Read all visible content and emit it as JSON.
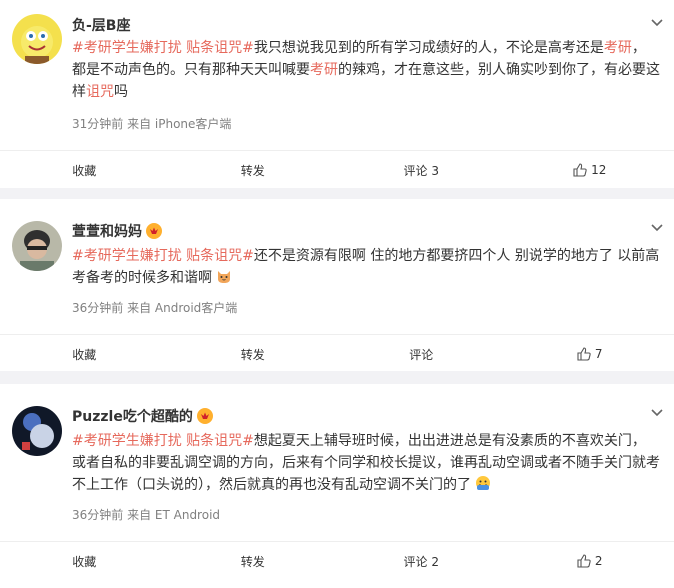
{
  "comments": [
    {
      "author": "负-层B座",
      "text_parts": [
        {
          "t": "#考研学生嫌打扰 贴条诅咒#",
          "hl": true
        },
        {
          "t": "我只想说我见到的所有学习成绩好的人，不论是高考还是",
          "hl": false
        },
        {
          "t": "考研",
          "hl": true
        },
        {
          "t": "，\n都是不动声色的。只有那种天天叫喊要",
          "hl": false
        },
        {
          "t": "考研",
          "hl": true
        },
        {
          "t": "的辣鸡，才在意这些，别人确实吵到你了，有必要这\n样",
          "hl": false
        },
        {
          "t": "诅咒",
          "hl": true
        },
        {
          "t": "吗",
          "hl": false
        }
      ],
      "meta": "31分钟前 来自 iPhone客户端",
      "actions": {
        "collect": "收藏",
        "repost": "转发",
        "comment": "评论 3",
        "like": "12"
      }
    },
    {
      "author": "萱萱和妈妈",
      "text_parts": [
        {
          "t": "#考研学生嫌打扰 贴条诅咒#",
          "hl": true
        },
        {
          "t": "还不是资源有限啊 住的地方都要挤四个人 别说学的地方了 以前高\n考备考的时候多和谐啊",
          "hl": false
        }
      ],
      "meta": "36分钟前 来自 Android客户端",
      "actions": {
        "collect": "收藏",
        "repost": "转发",
        "comment": "评论",
        "like": "7"
      }
    },
    {
      "author": "Puzzle吃个超酷的",
      "text_parts": [
        {
          "t": "#考研学生嫌打扰 贴条诅咒#",
          "hl": true
        },
        {
          "t": "想起夏天上辅导班时候，出出进进总是有没素质的不喜欢关门，\n或者自私的非要乱调空调的方向，后来有个同学和校长提议，谁再乱动空调或者不随手关门就考\n不上工作（口头说的），然后就真的再也没有乱动空调不关门的了",
          "hl": false
        }
      ],
      "meta": "36分钟前 来自 ET Android",
      "actions": {
        "collect": "收藏",
        "repost": "转发",
        "comment": "评论 2",
        "like": "2"
      }
    }
  ]
}
